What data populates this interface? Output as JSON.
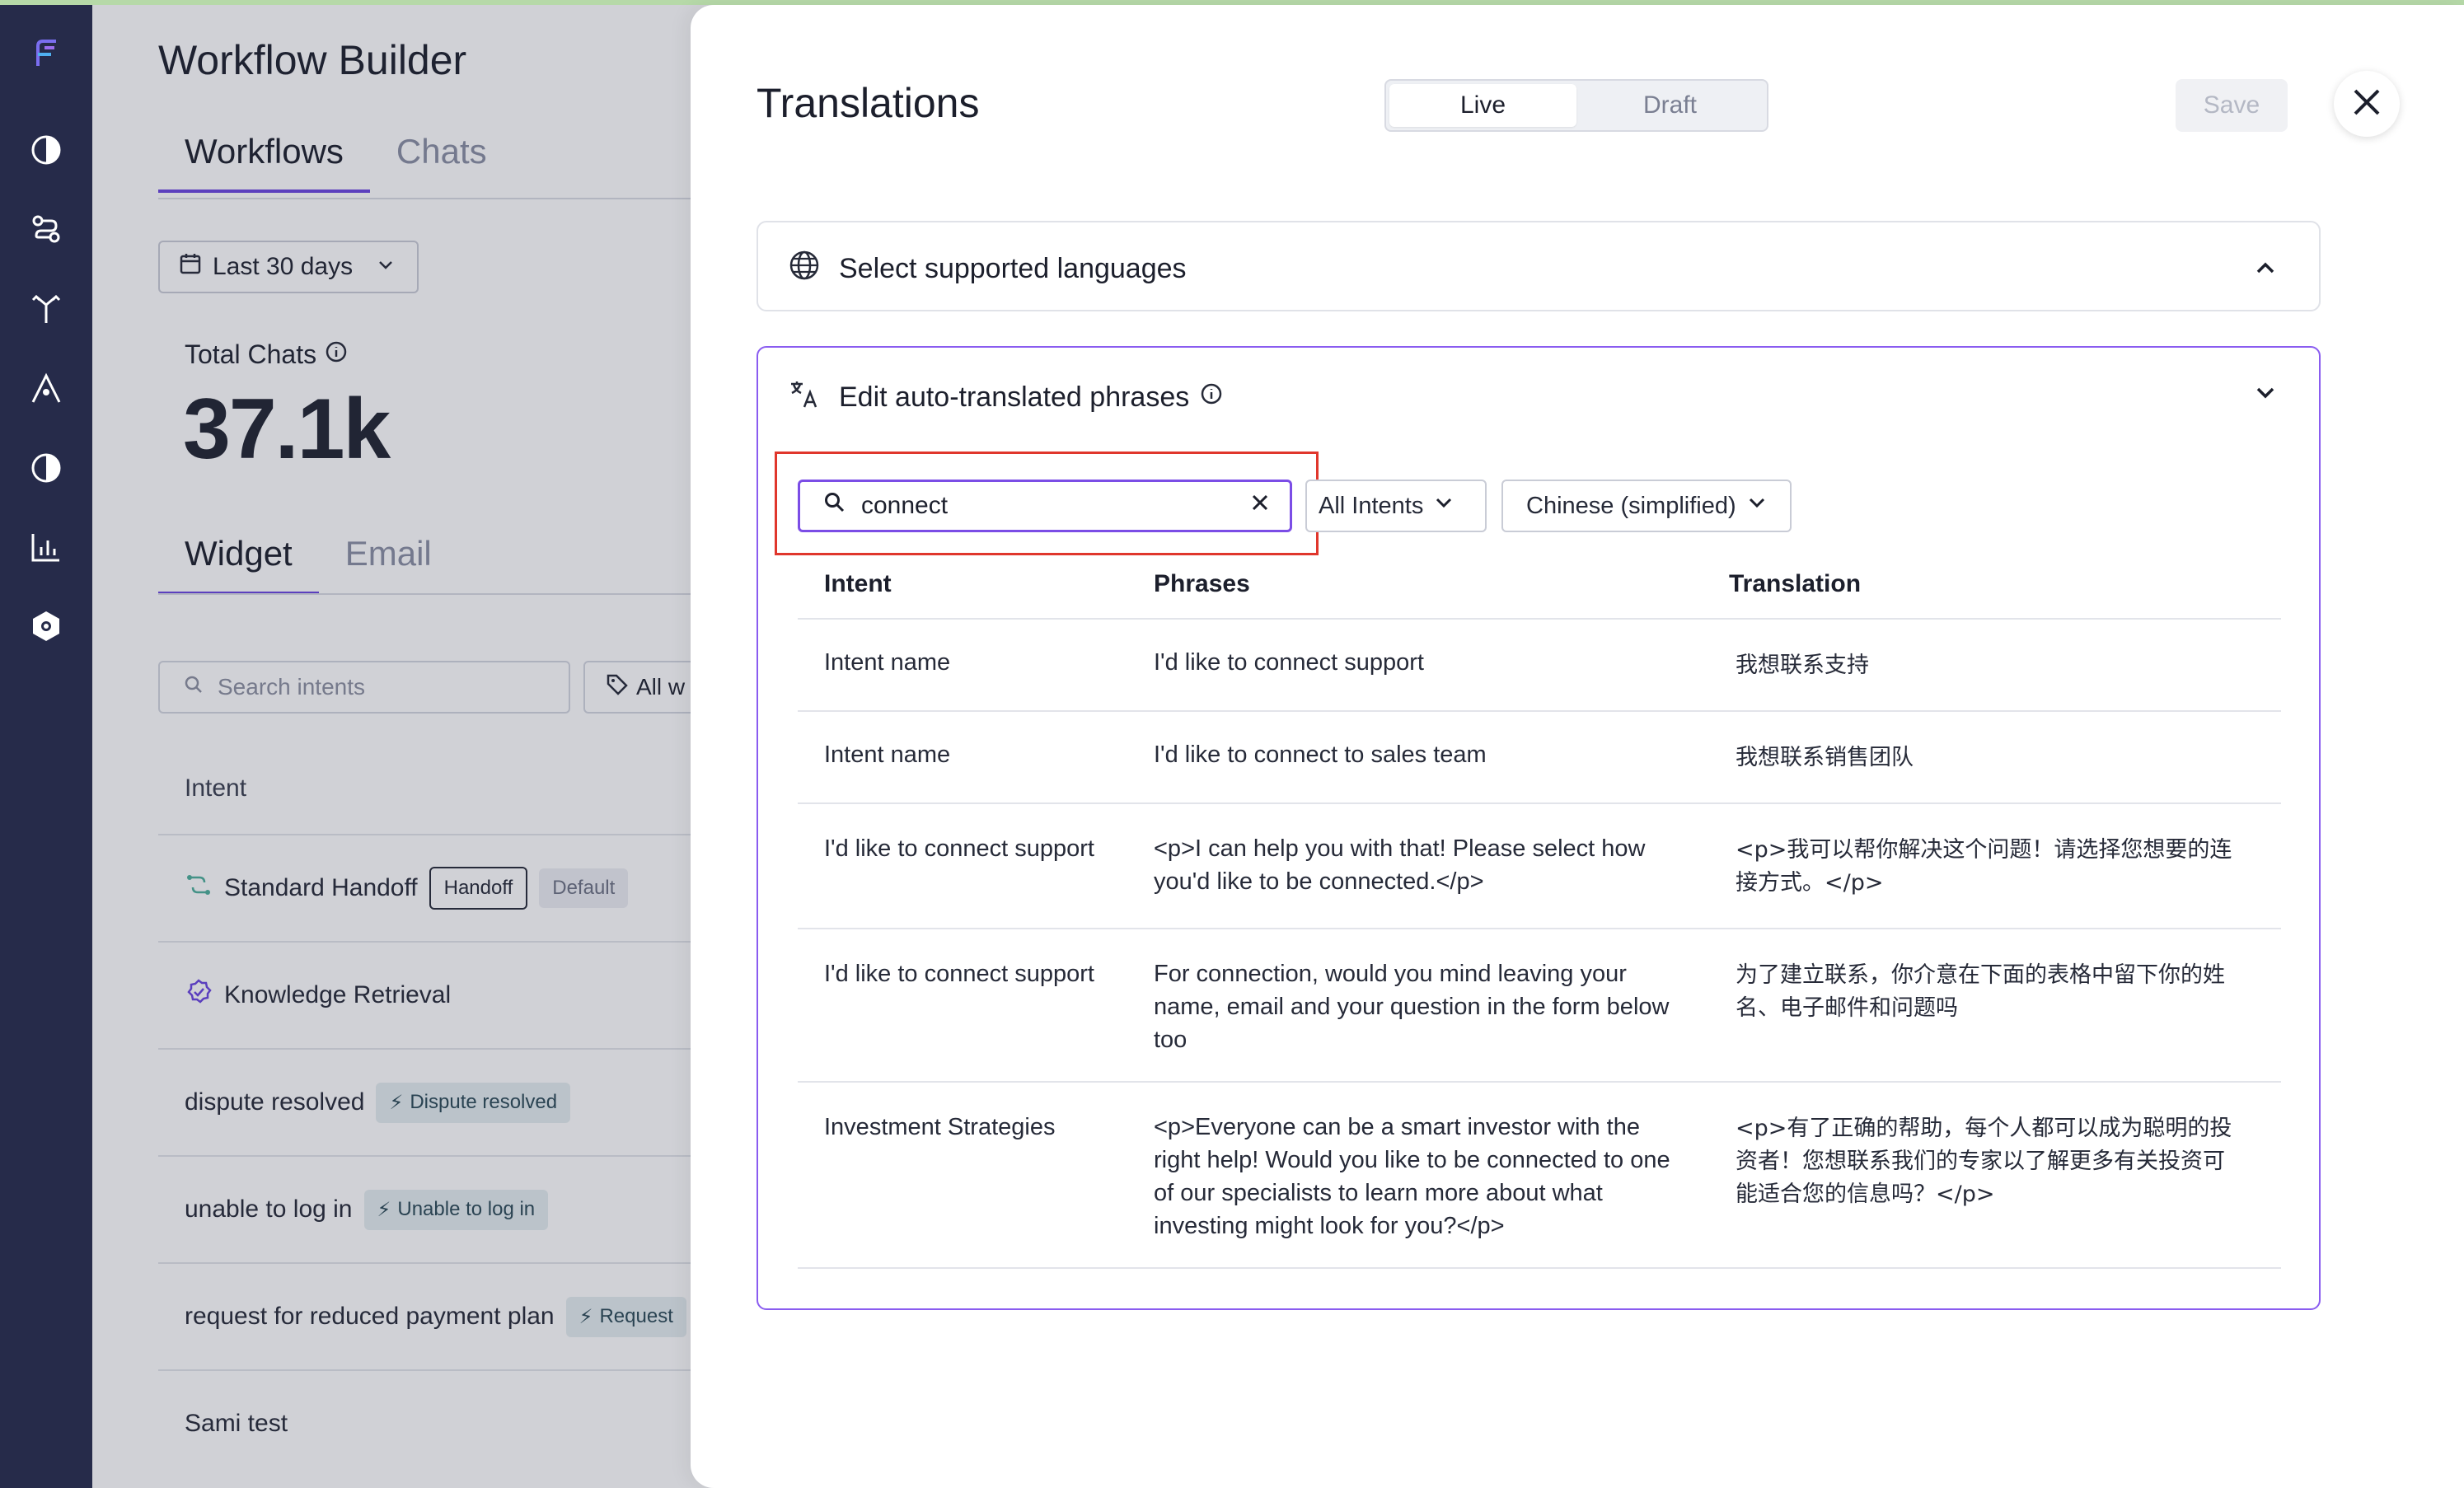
{
  "background": {
    "title": "Workflow Builder",
    "tabs_top": [
      "Workflows",
      "Chats"
    ],
    "date_filter": "Last 30 days",
    "total_chats_label": "Total Chats",
    "total_chats_value": "37.1k",
    "tabs_channel": [
      "Widget",
      "Email"
    ],
    "search_placeholder": "Search intents",
    "filter_label": "All w",
    "intent_header": "Intent",
    "rows": [
      {
        "name": "Standard Handoff",
        "badge1": "Handoff",
        "badge2": "Default"
      },
      {
        "name": "Knowledge Retrieval"
      },
      {
        "name": "dispute resolved",
        "action": "Dispute resolved"
      },
      {
        "name": "unable to log in",
        "action": "Unable to log in"
      },
      {
        "name": "request for reduced payment plan",
        "action": "Request"
      },
      {
        "name": "Sami test"
      }
    ]
  },
  "modal": {
    "title": "Translations",
    "segments": [
      "Live",
      "Draft"
    ],
    "active_segment": "Live",
    "save_label": "Save",
    "section1_title": "Select supported languages",
    "section2_title": "Edit auto-translated phrases",
    "search_value": "connect",
    "intent_filter": "All Intents",
    "language_filter": "Chinese (simplified)",
    "columns": [
      "Intent",
      "Phrases",
      "Translation"
    ],
    "rows": [
      {
        "intent": "Intent name",
        "phrase": "I'd like to connect support",
        "translation": "我想联系支持"
      },
      {
        "intent": "Intent name",
        "phrase": "I'd like to connect to sales team",
        "translation": "我想联系销售团队"
      },
      {
        "intent": "I'd like to connect support",
        "phrase": "<p>I can help you with that! Please select how you'd like to be connected.</p>",
        "translation": "<p>我可以帮你解决这个问题！请选择您想要的连接方式。</p>"
      },
      {
        "intent": "I'd like to connect support",
        "phrase": "For connection, would you mind leaving your name, email and your question in the form below too",
        "translation": "为了建立联系，你介意在下面的表格中留下你的姓名、电子邮件和问题吗"
      },
      {
        "intent": "Investment Strategies",
        "phrase": "<p>Everyone can be a smart investor with the right help! Would you like to be connected to one of our specialists to learn more about what investing might look for you?</p>",
        "translation": "<p>有了正确的帮助，每个人都可以成为聪明的投资者！您想联系我们的专家以了解更多有关投资可能适合您的信息吗？</p>"
      }
    ]
  },
  "colors": {
    "rail": "#262b4a",
    "accent": "#7b4de6",
    "highlight": "#e0362c"
  }
}
